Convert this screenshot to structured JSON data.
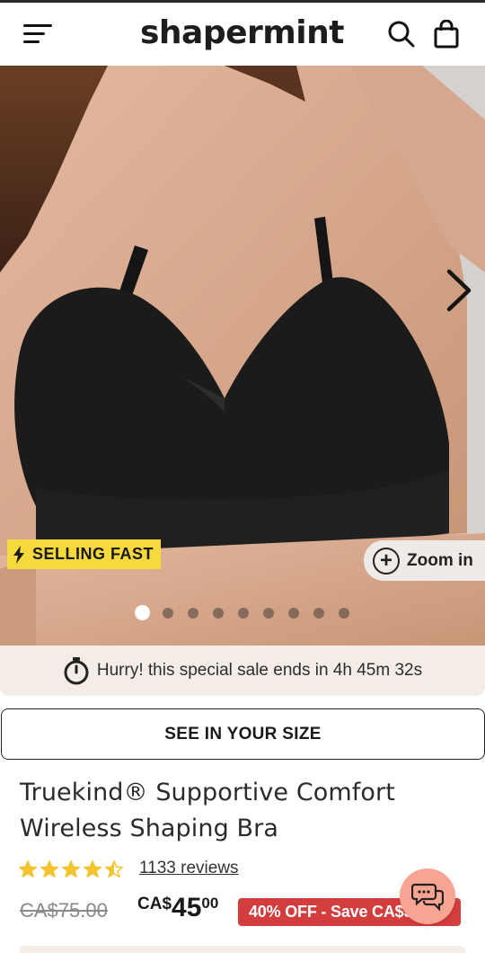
{
  "header": {
    "logo": "shapermint",
    "menu_icon": "hamburger-menu-icon",
    "search_icon": "search-icon",
    "cart_icon": "shopping-bag-icon"
  },
  "gallery": {
    "badge": "SELLING FAST",
    "zoom_label": "Zoom in",
    "image_count": 9,
    "active_index": 0
  },
  "sale_timer": {
    "text": "Hurry! this special sale ends in 4h 45m 32s"
  },
  "size_button": "SEE IN YOUR SIZE",
  "product": {
    "title": "Truekind® Supportive Comfort Wireless Shaping Bra",
    "rating": 4.5,
    "reviews": "1133 reviews",
    "old_price": "CA$75.00",
    "price_currency": "CA$",
    "price_whole": "45",
    "price_cents": "00",
    "discount": "40% OFF - Save CA$30"
  },
  "colors": {
    "badge_yellow": "#f5d93d",
    "discount_red": "#d43d3d",
    "star_yellow": "#f2c530",
    "chat_coral": "#f7a493",
    "timer_bg": "#f4ece6"
  }
}
